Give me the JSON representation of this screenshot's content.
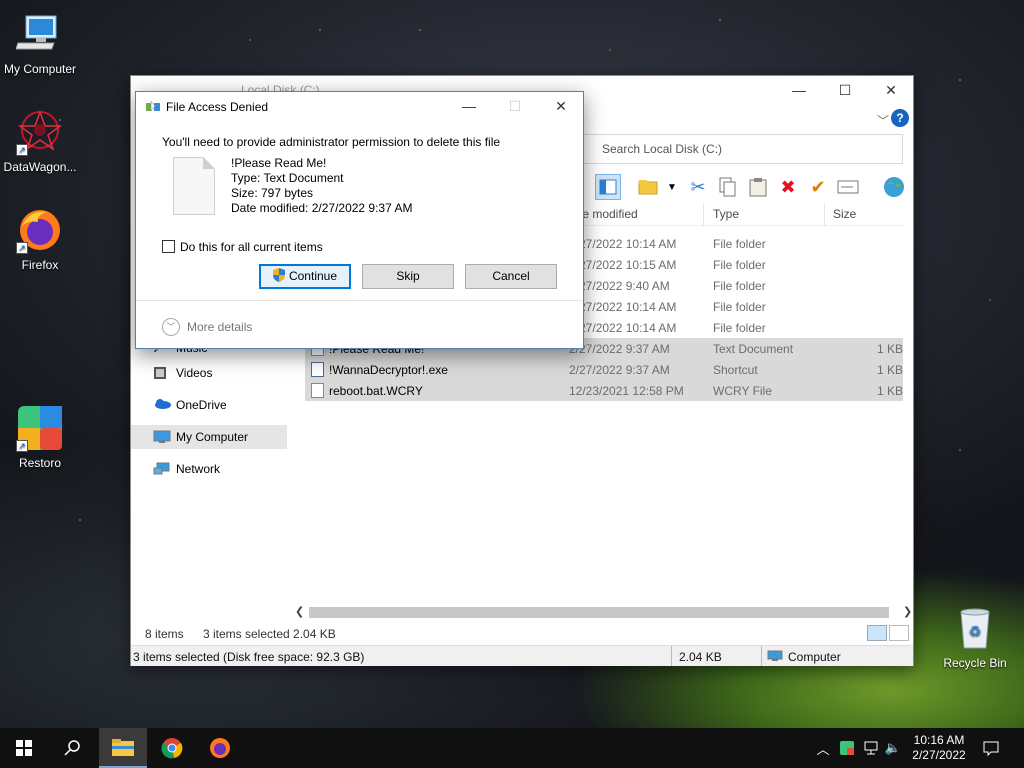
{
  "desktop": {
    "icons": [
      {
        "label": "My Computer"
      },
      {
        "label": "DataWagon..."
      },
      {
        "label": "Firefox"
      },
      {
        "label": "Restoro"
      },
      {
        "label": "Recycle Bin"
      }
    ]
  },
  "explorer": {
    "title": "Local Disk (C:)",
    "search_placeholder": "Search Local Disk (C:)",
    "columns": {
      "date": "te modified",
      "type": "Type",
      "size": "Size"
    },
    "rows": [
      {
        "name": "",
        "date": "2/27/2022 10:14 AM",
        "type": "File folder",
        "size": ""
      },
      {
        "name": "",
        "date": "2/27/2022 10:15 AM",
        "type": "File folder",
        "size": ""
      },
      {
        "name": "",
        "date": "2/27/2022 9:40 AM",
        "type": "File folder",
        "size": ""
      },
      {
        "name": "",
        "date": "2/27/2022 10:14 AM",
        "type": "File folder",
        "size": ""
      },
      {
        "name": "",
        "date": "2/27/2022 10:14 AM",
        "type": "File folder",
        "size": ""
      },
      {
        "name": "!Please Read Me!",
        "date": "2/27/2022 9:37 AM",
        "type": "Text Document",
        "size": "1 KB"
      },
      {
        "name": "!WannaDecryptor!.exe",
        "date": "2/27/2022 9:37 AM",
        "type": "Shortcut",
        "size": "1 KB"
      },
      {
        "name": "reboot.bat.WCRY",
        "date": "12/23/2021 12:58 PM",
        "type": "WCRY File",
        "size": "1 KB"
      }
    ],
    "nav": [
      {
        "label": "Music"
      },
      {
        "label": "Videos"
      },
      {
        "label": "OneDrive"
      },
      {
        "label": "My Computer"
      },
      {
        "label": "Network"
      }
    ],
    "status": {
      "items": "8 items",
      "selected": "3 items selected  2.04 KB",
      "bottom_left": "3 items selected (Disk free space: 92.3 GB)",
      "bottom_size": "2.04 KB",
      "bottom_location": "Computer"
    }
  },
  "dialog": {
    "title": "File Access Denied",
    "message": "You'll need to provide administrator permission to delete this file",
    "file_name": "!Please Read Me!",
    "file_type": "Type: Text Document",
    "file_size": "Size: 797 bytes",
    "file_modified": "Date modified: 2/27/2022 9:37 AM",
    "checkbox_label": "Do this for all current items",
    "checkbox_checked": false,
    "continue_label": "Continue",
    "skip_label": "Skip",
    "cancel_label": "Cancel",
    "more_details_label": "More details"
  },
  "taskbar": {
    "time": "10:16 AM",
    "date": "2/27/2022"
  },
  "colors": {
    "accent": "#0078d7",
    "delete_red": "#e81123",
    "check_orange": "#e07a10",
    "taskbar": "#101010"
  }
}
